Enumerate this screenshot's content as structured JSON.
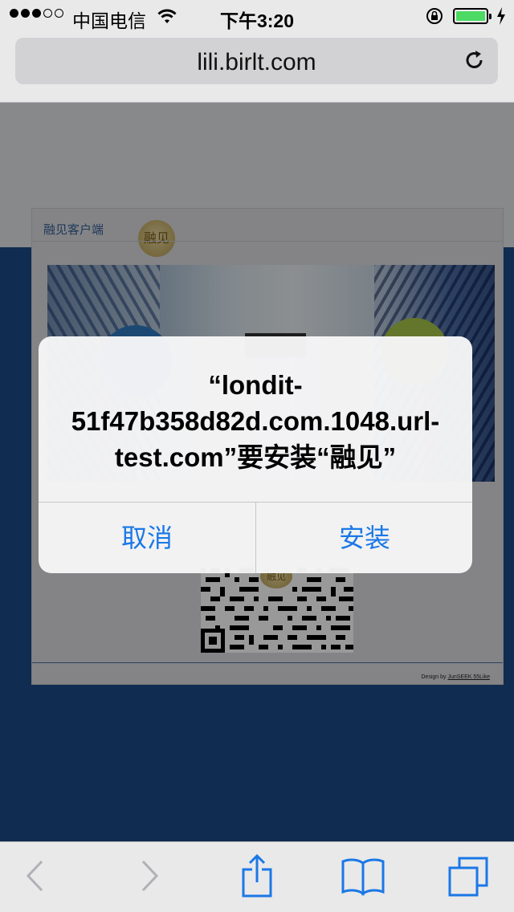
{
  "status_bar": {
    "carrier": "中国电信",
    "time": "下午3:20",
    "battery_color": "#4cd964",
    "icons": [
      "signal-dots",
      "wifi-icon",
      "orientation-lock-icon",
      "battery-icon",
      "charging-icon"
    ]
  },
  "address_bar": {
    "url": "lili.birlt.com",
    "reload_icon": "reload-icon"
  },
  "page": {
    "card_title": "融见客户端",
    "logo_text": "融见",
    "credits_prefix": "Design by ",
    "credits_link": "JunSEEK 55Like"
  },
  "alert": {
    "message": "“londit-51f47b358d82d.com.1048.url-test.com”要安装“融见”",
    "cancel_label": "取消",
    "install_label": "安装",
    "button_color": "#1b78e6"
  },
  "toolbar": {
    "icons": [
      "back-icon",
      "forward-icon",
      "share-icon",
      "bookmarks-icon",
      "tabs-icon"
    ],
    "active_color": "#1b78e6",
    "disabled_color": "#b0b0b5"
  }
}
